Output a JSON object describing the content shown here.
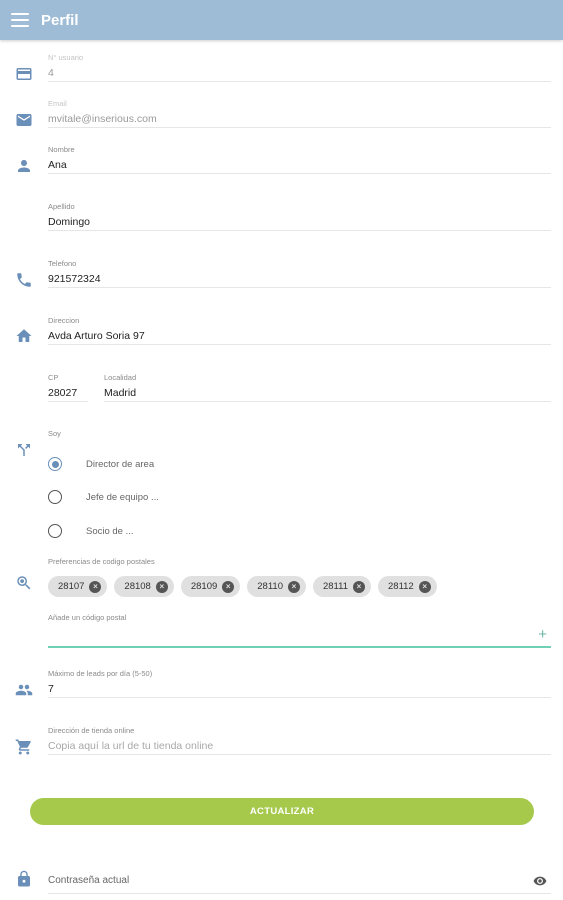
{
  "appbar": {
    "title": "Perfil",
    "menu_icon": "menu-icon"
  },
  "form": {
    "id": {
      "label": "N° usuario",
      "value": "4"
    },
    "email": {
      "label": "Email",
      "value": "mvitale@inserious.com"
    },
    "nombre": {
      "label": "Nombre",
      "value": "Ana"
    },
    "apellido": {
      "label": "Apellido",
      "value": "Domingo"
    },
    "telefono": {
      "label": "Telefono",
      "value": "921572324"
    },
    "direccion": {
      "label": "Direccion",
      "value": "Avda Arturo Soria 97"
    },
    "cp": {
      "label": "CP",
      "value": "28027"
    },
    "localidad": {
      "label": "Localidad",
      "value": "Madrid"
    },
    "soy": {
      "label": "Soy",
      "options": [
        "Director de area",
        "Jefe de equipo ...",
        "Socio de ..."
      ],
      "selected": "Director de area"
    },
    "preferencias": {
      "label": "Preferencias de codigo postales",
      "chips": [
        "28107",
        "28108",
        "28109",
        "28110",
        "28111",
        "28112"
      ],
      "add_label": "Añade un código postal",
      "add_value": "",
      "add_icon": "+"
    },
    "leads": {
      "label": "Máximo de leads por día (5-50)",
      "value": "7"
    },
    "tienda": {
      "label": "Dirección de tienda online",
      "placeholder": "Copia aquí la url de tu tienda online"
    },
    "submit_label": "ACTUALIZAR",
    "password": {
      "placeholder": "Contraseña actual"
    }
  },
  "colors": {
    "appbar": "#9fbcd6",
    "icon": "#6a8fb8",
    "button": "#a6c94c",
    "focus_line": "#6fd0b6"
  }
}
